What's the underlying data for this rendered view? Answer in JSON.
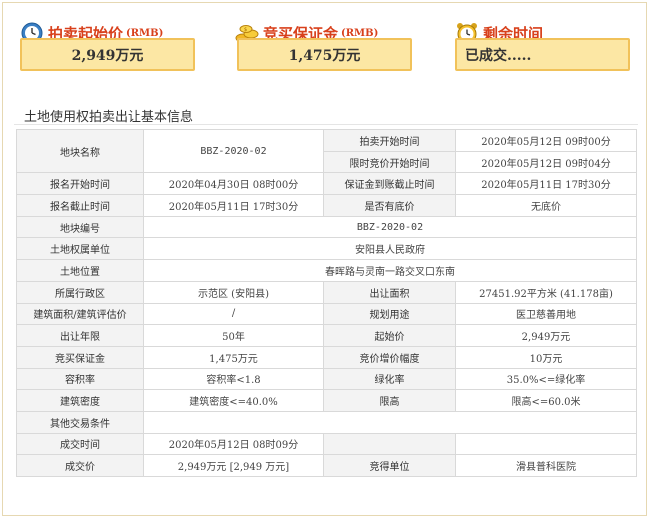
{
  "stats": {
    "start_price": {
      "title": "拍卖起始价",
      "unit": "(RMB)",
      "value": "2,949万元",
      "icon": "clock-icon"
    },
    "deposit": {
      "title": "竞买保证金",
      "unit": "(RMB)",
      "value": "1,475万元",
      "icon": "coins-icon"
    },
    "remaining": {
      "title": "剩余时间",
      "value": "已成交.....",
      "icon": "alarm-clock-icon"
    }
  },
  "section_title": "土地使用权拍卖出让基本信息",
  "table": {
    "r1": {
      "l1": "地块名称",
      "v1": "BBZ-2020-02",
      "l2": "拍卖开始时间",
      "v2": "2020年05月12日 09时00分"
    },
    "r2": {
      "l2": "限时竞价开始时间",
      "v2": "2020年05月12日 09时04分"
    },
    "r3": {
      "l1": "报名开始时间",
      "v1": "2020年04月30日 08时00分",
      "l2": "保证金到账截止时间",
      "v2": "2020年05月11日 17时30分"
    },
    "r4": {
      "l1": "报名截止时间",
      "v1": "2020年05月11日 17时30分",
      "l2": "是否有底价",
      "v2": "无底价"
    },
    "r5": {
      "l1": "地块编号",
      "v1": "BBZ-2020-02"
    },
    "r6": {
      "l1": "土地权属单位",
      "v1": "安阳县人民政府"
    },
    "r7": {
      "l1": "土地位置",
      "v1": "春晖路与灵南一路交叉口东南"
    },
    "r8": {
      "l1": "所属行政区",
      "v1": "示范区 (安阳县)",
      "l2": "出让面积",
      "v2": "27451.92平方米 (41.178亩)"
    },
    "r9": {
      "l1": "建筑面积/建筑评估价",
      "v1": "/",
      "l2": "规划用途",
      "v2": "医卫慈善用地"
    },
    "r10": {
      "l1": "出让年限",
      "v1": "50年",
      "l2": "起始价",
      "v2": "2,949万元"
    },
    "r11": {
      "l1": "竞买保证金",
      "v1": "1,475万元",
      "l2": "竞价增价幅度",
      "v2": "10万元"
    },
    "r12": {
      "l1": "容积率",
      "v1": "容积率<1.8",
      "l2": "绿化率",
      "v2": "35.0%<=绿化率"
    },
    "r13": {
      "l1": "建筑密度",
      "v1": "建筑密度<=40.0%",
      "l2": "限高",
      "v2": "限高<=60.0米"
    },
    "r14": {
      "l1": "其他交易条件",
      "v1": ""
    },
    "r15": {
      "l1": "成交时间",
      "v1": "2020年05月12日 08时09分",
      "l2": "",
      "v2": ""
    },
    "r16": {
      "l1": "成交价",
      "v1": "2,949万元 [2,949 万元]",
      "l2": "竞得单位",
      "v2": "滑县普科医院"
    }
  },
  "colors": {
    "accent": "#d8401b",
    "box_bg": "#fce7a4",
    "box_border": "#f1c25a",
    "label_bg": "#f3f3f3",
    "grid": "#d9d9d9"
  }
}
